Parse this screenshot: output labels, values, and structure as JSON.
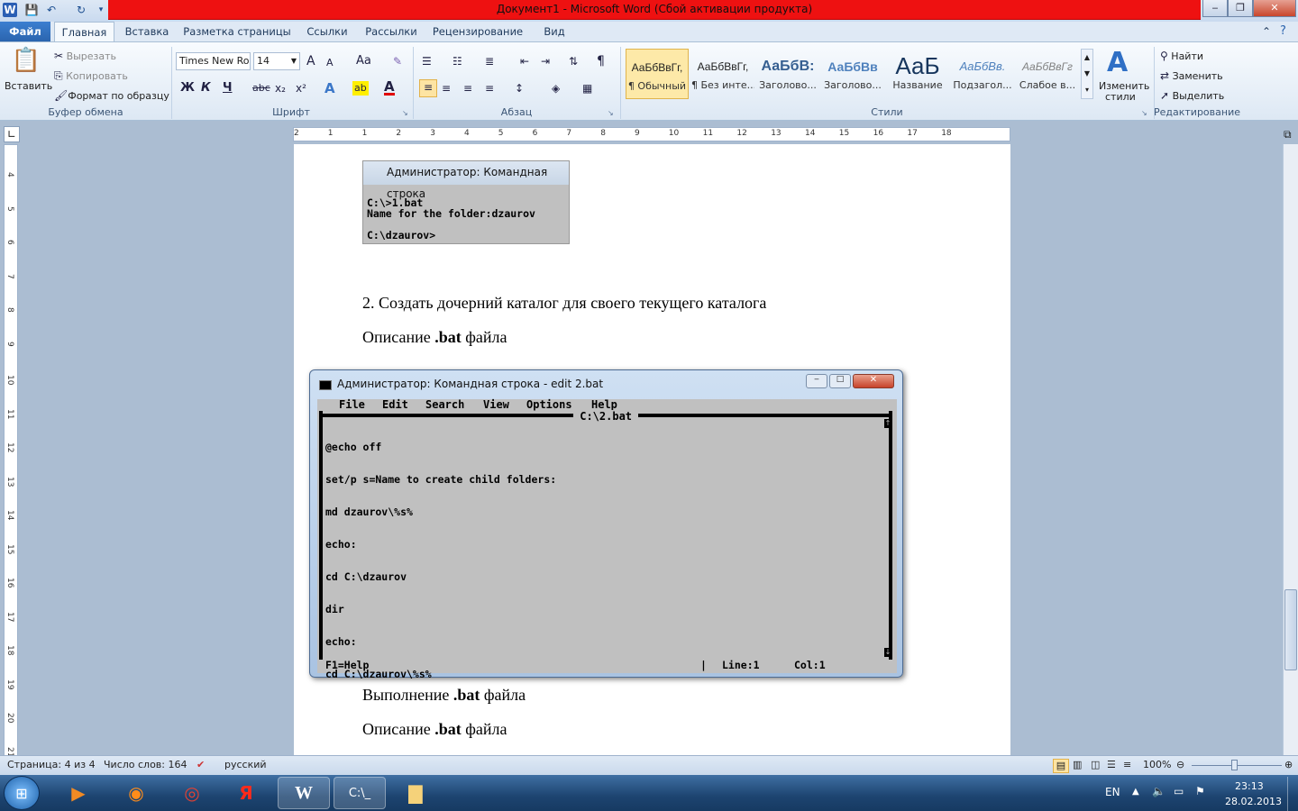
{
  "window": {
    "title": "Документ1  -  Microsoft Word (Сбой активации продукта)",
    "qat": {
      "word_icon": "word-icon",
      "save_icon": "save-icon",
      "undo_icon": "undo-icon",
      "redo_icon": "redo-icon"
    },
    "controls": {
      "minimize": "‒",
      "restore": "❐",
      "close": "✕"
    }
  },
  "tabs": [
    "Файл",
    "Главная",
    "Вставка",
    "Разметка страницы",
    "Ссылки",
    "Рассылки",
    "Рецензирование",
    "Вид"
  ],
  "ribbon": {
    "clipboard": {
      "paste": "Вставить",
      "cut": "Вырезать",
      "copy": "Копировать",
      "format_painter": "Формат по образцу",
      "label": "Буфер обмена"
    },
    "font": {
      "name": "Times New Ro",
      "size": "14",
      "label": "Шрифт",
      "grow": "A",
      "shrink": "A",
      "case": "Aa",
      "bold": "Ж",
      "italic": "К",
      "underline": "Ч",
      "strike": "abc",
      "sub": "x₂",
      "sup": "x²",
      "highlight": "ab",
      "color": "A"
    },
    "paragraph": {
      "label": "Абзац",
      "pilcrow": "¶"
    },
    "styles": {
      "label": "Стили",
      "items": [
        {
          "sample": "АаБбВвГг,",
          "name": "¶ Обычный"
        },
        {
          "sample": "АаБбВвГг,",
          "name": "¶ Без инте..."
        },
        {
          "sample": "АаБбВ:",
          "name": "Заголово..."
        },
        {
          "sample": "АаБбВв",
          "name": "Заголово..."
        },
        {
          "sample": "АаБ",
          "name": "Название"
        },
        {
          "sample": "АаБбВв.",
          "name": "Подзагол..."
        },
        {
          "sample": "АаБбВвГг",
          "name": "Слабое в..."
        }
      ],
      "change": "Изменить",
      "change2": "стили"
    },
    "editing": {
      "find": "Найти",
      "replace": "Заменить",
      "select": "Выделить",
      "label": "Редактирование"
    }
  },
  "ruler": {
    "horizontal": [
      "2",
      "1",
      "1",
      "2",
      "3",
      "4",
      "5",
      "6",
      "7",
      "8",
      "9",
      "10",
      "11",
      "12",
      "13",
      "14",
      "15",
      "16",
      "17",
      "18"
    ],
    "vertical": [
      "4",
      "5",
      "6",
      "7",
      "8",
      "9",
      "10",
      "11",
      "12",
      "13",
      "14",
      "15",
      "16",
      "17",
      "18",
      "19",
      "20",
      "21",
      "22"
    ]
  },
  "document": {
    "cmd1": {
      "title": "Администратор: Командная строка",
      "lines": [
        "C:\\>1.bat",
        "Name for the folder:dzaurov",
        "",
        "C:\\dzaurov>"
      ]
    },
    "item2": "2.  Создать дочерний каталог для своего текущего каталога",
    "desc1_pre": "Описание ",
    "desc1_b": ".bat",
    "desc1_post": " файла",
    "exec_pre": "Выполнение ",
    "exec_b": ".bat",
    "exec_post": " файла",
    "desc2_pre": "Описание ",
    "desc2_b": ".bat",
    "desc2_post": " файла"
  },
  "editor": {
    "title": "Администратор: Командная строка - edit  2.bat",
    "menu": [
      "File",
      "Edit",
      "Search",
      "View",
      "Options",
      "Help"
    ],
    "filename": " C:\\2.bat ",
    "lines": [
      "@echo off",
      "set/p s=Name to create child folders:",
      "md dzaurov\\%s%",
      "echo:",
      "cd C:\\dzaurov",
      "dir",
      "echo:",
      "cd C:\\dzaurov\\%s%"
    ],
    "status_help": "F1=Help",
    "status_line": "Line:1",
    "status_col": "Col:1",
    "status_sep": "|"
  },
  "statusbar": {
    "page": "Страница: 4 из 4",
    "words": "Число слов: 164",
    "lang": "русский",
    "zoom": "100%"
  },
  "taskbar": {
    "apps": [
      "media-player-icon",
      "firefox-icon",
      "chrome-icon",
      "yandex-icon",
      "word-icon",
      "cmd-icon",
      "explorer-icon"
    ],
    "lang": "EN",
    "time": "23:13",
    "date": "28.02.2013"
  }
}
